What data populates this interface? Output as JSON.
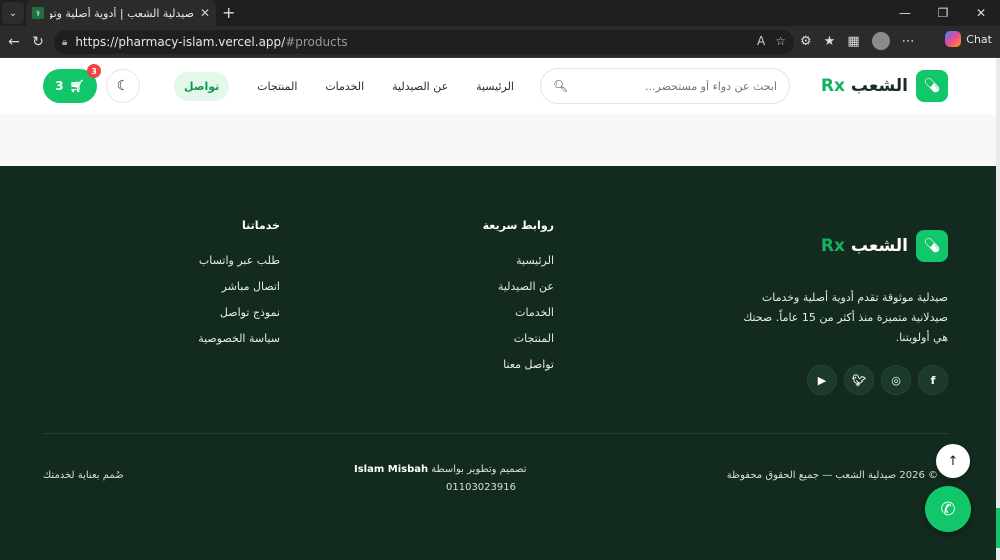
{
  "browser": {
    "tab_title": "صيدلية الشعب | أدوية أصلية وتوصيل",
    "url_main": "https://pharmacy-islam.vercel.app/",
    "url_hash": "#products",
    "chat_label": "Chat"
  },
  "header": {
    "logo_name": "الشعب",
    "logo_rx": "Rx",
    "search_placeholder": "ابحث عن دواء أو مستحضر...",
    "nav": [
      "الرئيسية",
      "عن الصيدلية",
      "الخدمات",
      "المنتجات",
      "تواصل"
    ],
    "cart_count": "3",
    "cart_badge": "3"
  },
  "footer": {
    "logo_name": "الشعب",
    "logo_rx": "Rx",
    "description": "صيدلية موثوقة تقدم أدوية أصلية وخدمات صيدلانية متميزة منذ أكثر من 15 عاماً. صحتك هي أولويتنا.",
    "quick_links_title": "روابط سريعة",
    "quick_links": [
      "الرئيسية",
      "عن الصيدلية",
      "الخدمات",
      "المنتجات",
      "تواصل معنا"
    ],
    "services_title": "خدماتنا",
    "services": [
      "طلب عبر واتساب",
      "اتصال مباشر",
      "نموذج تواصل",
      "سياسة الخصوصية"
    ],
    "copyright": "© 2026 صيدلية الشعب — جميع الحقوق محفوظة",
    "credit_prefix": "تصميم وتطوير بواسطة",
    "credit_author": "Islam Misbah",
    "credit_phone": "01103023916",
    "made_with": "صُمم بعناية لخدمتك"
  },
  "colors": {
    "brand_green": "#12c66a",
    "footer_bg": "#132a1e"
  }
}
